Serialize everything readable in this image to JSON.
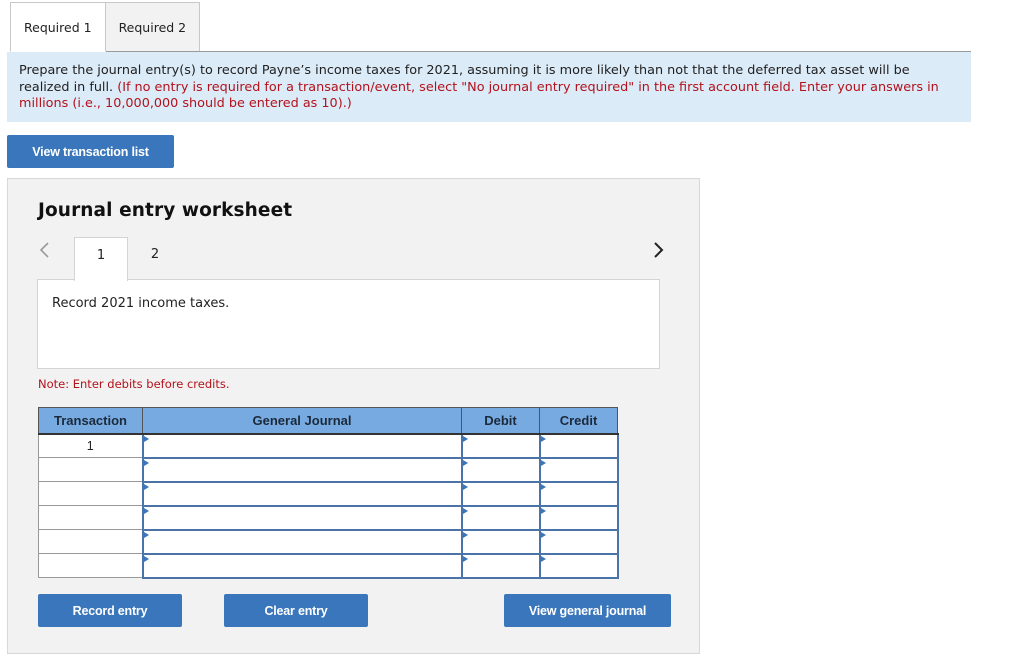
{
  "tabs": [
    {
      "label": "Required 1",
      "active": true
    },
    {
      "label": "Required 2",
      "active": false
    }
  ],
  "instructions": {
    "text": "Prepare the journal entry(s) to record Payne’s income taxes for 2021, assuming it is more likely than not that the deferred tax asset will be realized in full.",
    "note": "(If no entry is required for a transaction/event, select \"No journal entry required\" in the first account field. Enter your answers in millions (i.e., 10,000,000 should be entered as 10).)"
  },
  "view_transaction_list_label": "View transaction list",
  "worksheet": {
    "title": "Journal entry worksheet",
    "prev_icon": "chevron-left-icon",
    "next_icon": "chevron-right-icon",
    "entry_tabs": [
      "1",
      "2"
    ],
    "active_entry": "1",
    "description": "Record 2021 income taxes.",
    "note": "Note: Enter debits before credits.",
    "table": {
      "headers": [
        "Transaction",
        "General Journal",
        "Debit",
        "Credit"
      ],
      "rows": [
        {
          "transaction": "1",
          "account": "",
          "debit": "",
          "credit": ""
        },
        {
          "transaction": "",
          "account": "",
          "debit": "",
          "credit": ""
        },
        {
          "transaction": "",
          "account": "",
          "debit": "",
          "credit": ""
        },
        {
          "transaction": "",
          "account": "",
          "debit": "",
          "credit": ""
        },
        {
          "transaction": "",
          "account": "",
          "debit": "",
          "credit": ""
        },
        {
          "transaction": "",
          "account": "",
          "debit": "",
          "credit": ""
        }
      ]
    },
    "buttons": {
      "record": "Record entry",
      "clear": "Clear entry",
      "view_general_journal": "View general journal"
    }
  },
  "colors": {
    "accent_button": "#3a76bb",
    "instruction_bg": "#dcebf8",
    "note_red": "#b3121b",
    "table_header": "#78aae2"
  }
}
